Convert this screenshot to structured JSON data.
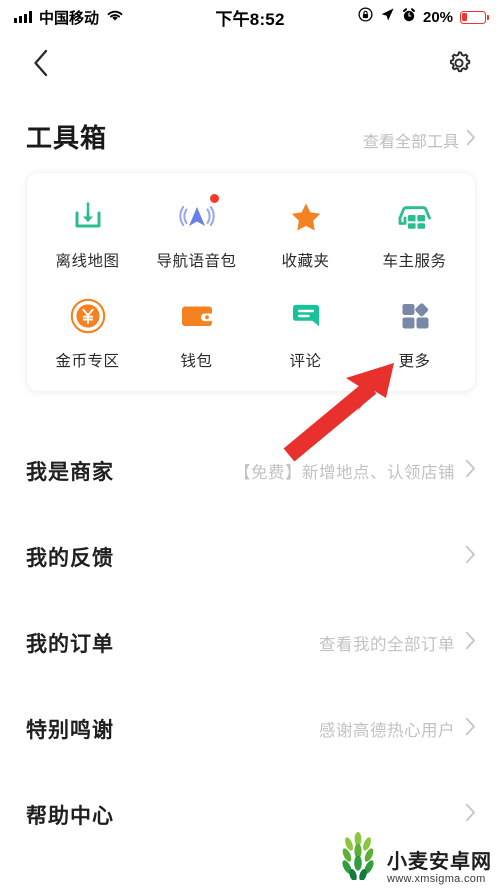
{
  "statusbar": {
    "carrier": "中国移动",
    "time": "下午8:52",
    "battery_percent": "20%",
    "icons": [
      "signal-bars-icon",
      "wifi-icon",
      "rotation-lock-icon",
      "location-arrow-icon",
      "alarm-clock-icon",
      "battery-icon"
    ],
    "battery_color": "#f03434"
  },
  "navbar": {
    "back_icon": "back-chevron-icon",
    "settings_icon": "gear-icon"
  },
  "section": {
    "title": "工具箱",
    "see_all_label": "查看全部工具",
    "chevron": "›"
  },
  "tools": [
    {
      "label": "离线地图",
      "icon": "offline-map-download-icon",
      "color": "#2bbd92",
      "badge": false
    },
    {
      "label": "导航语音包",
      "icon": "navigation-voice-icon",
      "color": "#6b7fe8",
      "badge": true
    },
    {
      "label": "收藏夹",
      "icon": "star-icon",
      "color": "#f58220",
      "badge": false
    },
    {
      "label": "车主服务",
      "icon": "car-service-icon",
      "color": "#2bbd92",
      "badge": false
    },
    {
      "label": "金币专区",
      "icon": "gold-coin-icon",
      "color": "#f58220",
      "badge": false
    },
    {
      "label": "钱包",
      "icon": "wallet-icon",
      "color": "#f58220",
      "badge": false
    },
    {
      "label": "评论",
      "icon": "comment-bubble-icon",
      "color": "#17c39a",
      "badge": false
    },
    {
      "label": "更多",
      "icon": "more-grid-icon",
      "color": "#7a88a8",
      "badge": false
    }
  ],
  "list_rows": [
    {
      "title": "我是商家",
      "subtitle": "【免费】新增地点、认领店铺"
    },
    {
      "title": "我的反馈",
      "subtitle": ""
    },
    {
      "title": "我的订单",
      "subtitle": "查看我的全部订单"
    },
    {
      "title": "特别鸣谢",
      "subtitle": "感谢高德热心用户"
    },
    {
      "title": "帮助中心",
      "subtitle": ""
    }
  ],
  "annotation": {
    "type": "red-arrow",
    "color": "#e8302c",
    "points_to": "更多"
  },
  "watermark": {
    "title": "小麦安卓网",
    "url": "www.xmsigma.com",
    "logo": "wheat-logo-icon"
  }
}
